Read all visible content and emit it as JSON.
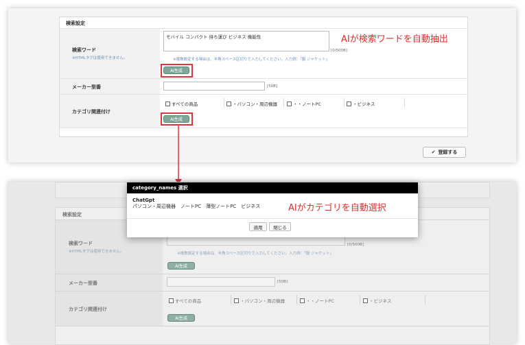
{
  "top": {
    "section_title": "検索設定",
    "keyword": {
      "label": "検索ワード",
      "html_note": "※HTMLタグは使用できません。",
      "value": "モバイル コンパクト 持ち運び ビジネス 機能性",
      "counter": "[0/500B]",
      "hint": "※複数設定する場合は、半角スペース区切りで入力してください。入力例：「服 ジャケット」",
      "ai_button": "AI生成"
    },
    "maker": {
      "label": "メーカー型番",
      "counter": "[50B]"
    },
    "category": {
      "label": "カテゴリ関連付け",
      "options": [
        "すべての商品",
        "・パソコン・周辺機器",
        "・・ノートPC",
        "・ビジネス"
      ],
      "ai_button": "AI生成"
    },
    "register_button": "登録する",
    "annotation": "AIが検索ワードを自動抽出"
  },
  "bottom": {
    "section_title": "検索設定",
    "keyword": {
      "label": "検索ワード",
      "html_note": "※HTMLタグは使用できません。",
      "counter": "[0/500B]",
      "hint": "※複数設定する場合は、半角スペース区切りで入力してください。入力例：「服 ジャケット」",
      "ai_button": "AI生成"
    },
    "maker": {
      "label": "メーカー型番",
      "counter": "[50B]"
    },
    "category": {
      "label": "カテゴリ関連付け",
      "options": [
        "すべての商品",
        "・パソコン・周辺機器",
        "・・ノートPC",
        "・ビジネス"
      ],
      "ai_button": "AI生成"
    }
  },
  "modal": {
    "title": "category_names 選択",
    "source": "ChatGpt",
    "result": "パソコン・周辺機器　ノートPC　薄型ノートPC　ビジネス",
    "apply_button": "適用",
    "close_button": "閉じる",
    "annotation": "AIがカテゴリを自動選択"
  },
  "colors": {
    "annotation_red": "#e02c2c",
    "ai_button": "#7fa898",
    "modal_header": "#000000"
  }
}
